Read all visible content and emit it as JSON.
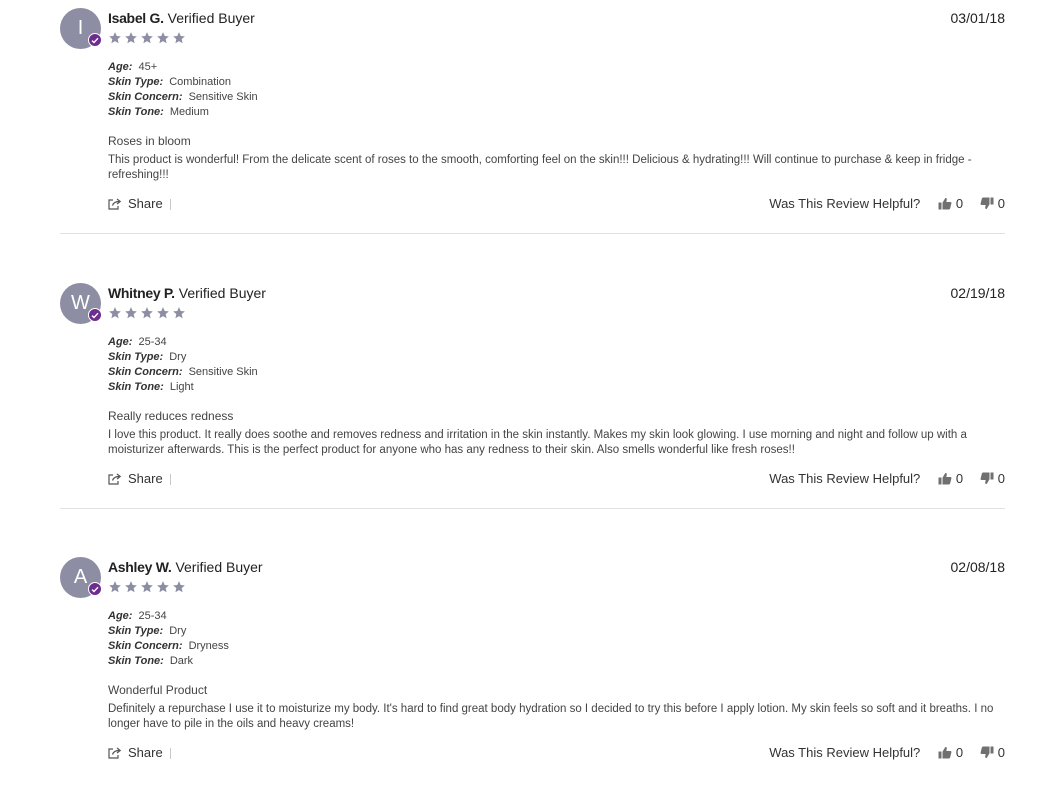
{
  "labels": {
    "verified": "Verified Buyer",
    "share": "Share",
    "helpful": "Was This Review Helpful?",
    "age": "Age:",
    "skin_type": "Skin Type:",
    "skin_concern": "Skin Concern:",
    "skin_tone": "Skin Tone:"
  },
  "colors": {
    "avatar": "#8d8ea3",
    "badge": "#6e2d8e",
    "star": "#8d8ea3"
  },
  "reviews": [
    {
      "initial": "I",
      "name": "Isabel G.",
      "date": "03/01/18",
      "rating": 5,
      "age": "45+",
      "skin_type": "Combination",
      "skin_concern": "Sensitive Skin",
      "skin_tone": "Medium",
      "title": "Roses in bloom",
      "body": "This product is wonderful! From the delicate scent of roses to the smooth, comforting feel on the skin!!! Delicious & hydrating!!! Will continue to purchase & keep in fridge - refreshing!!!",
      "helpful_yes": "0",
      "helpful_no": "0"
    },
    {
      "initial": "W",
      "name": "Whitney P.",
      "date": "02/19/18",
      "rating": 5,
      "age": "25-34",
      "skin_type": "Dry",
      "skin_concern": "Sensitive Skin",
      "skin_tone": "Light",
      "title": "Really reduces redness",
      "body": "I love this product. It really does soothe and removes redness and irritation in the skin instantly. Makes my skin look glowing. I use morning and night and follow up with a moisturizer afterwards. This is the perfect product for anyone who has any redness to their skin. Also smells wonderful like fresh roses!!",
      "helpful_yes": "0",
      "helpful_no": "0"
    },
    {
      "initial": "A",
      "name": "Ashley W.",
      "date": "02/08/18",
      "rating": 5,
      "age": "25-34",
      "skin_type": "Dry",
      "skin_concern": "Dryness",
      "skin_tone": "Dark",
      "title": "Wonderful Product",
      "body": "Definitely a repurchase I use it to moisturize my body. It's hard to find great body hydration so I decided to try this before I apply lotion. My skin feels so soft and it breaths. I no longer have to pile in the oils and heavy creams!",
      "helpful_yes": "0",
      "helpful_no": "0"
    }
  ]
}
